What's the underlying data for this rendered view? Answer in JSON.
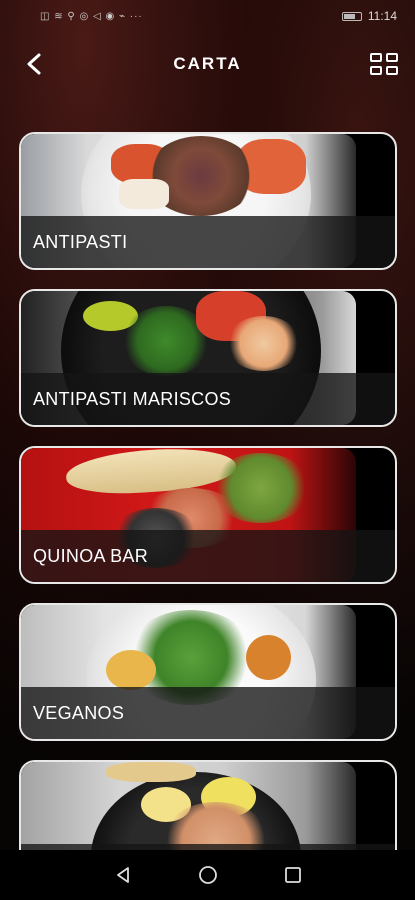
{
  "status_bar": {
    "time": "11:14",
    "notification_icons": "◫ ≋ ⚲ ◎ ◁ ◉ ⌁ ···"
  },
  "header": {
    "title": "CARTA"
  },
  "icons": {
    "back": "back-arrow-icon",
    "layout": "grid-view-icon",
    "nav_back": "nav-back-icon",
    "nav_home": "nav-home-icon",
    "nav_recent": "nav-recent-icon"
  },
  "colors": {
    "card_border": "#e8e8e8",
    "label_bar": "#141414",
    "background": "#070404"
  },
  "categories": [
    {
      "label": "ANTIPASTI"
    },
    {
      "label": "ANTIPASTI MARISCOS"
    },
    {
      "label": "QUINOA BAR"
    },
    {
      "label": "VEGANOS"
    },
    {
      "label": ""
    }
  ]
}
